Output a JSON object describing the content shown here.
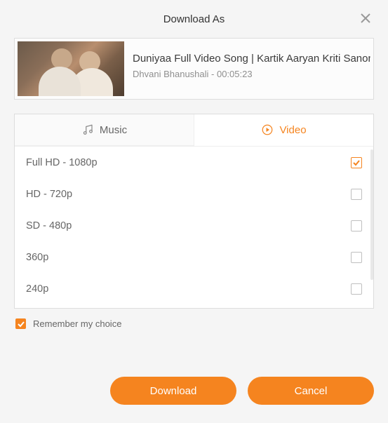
{
  "header": {
    "title": "Download As"
  },
  "media": {
    "title": "Duniyaa Full Video Song | Kartik Aaryan Kriti Sanon | A",
    "artist": "Dhvani Bhanushali",
    "duration": "00:05:23"
  },
  "tabs": {
    "music": "Music",
    "video": "Video",
    "active": "video"
  },
  "options": [
    {
      "label": "Full HD - 1080p",
      "selected": true
    },
    {
      "label": "HD - 720p",
      "selected": false
    },
    {
      "label": "SD - 480p",
      "selected": false
    },
    {
      "label": "360p",
      "selected": false
    },
    {
      "label": "240p",
      "selected": false
    }
  ],
  "remember": {
    "label": "Remember my choice",
    "checked": true
  },
  "buttons": {
    "download": "Download",
    "cancel": "Cancel"
  },
  "colors": {
    "accent": "#f5841f"
  }
}
